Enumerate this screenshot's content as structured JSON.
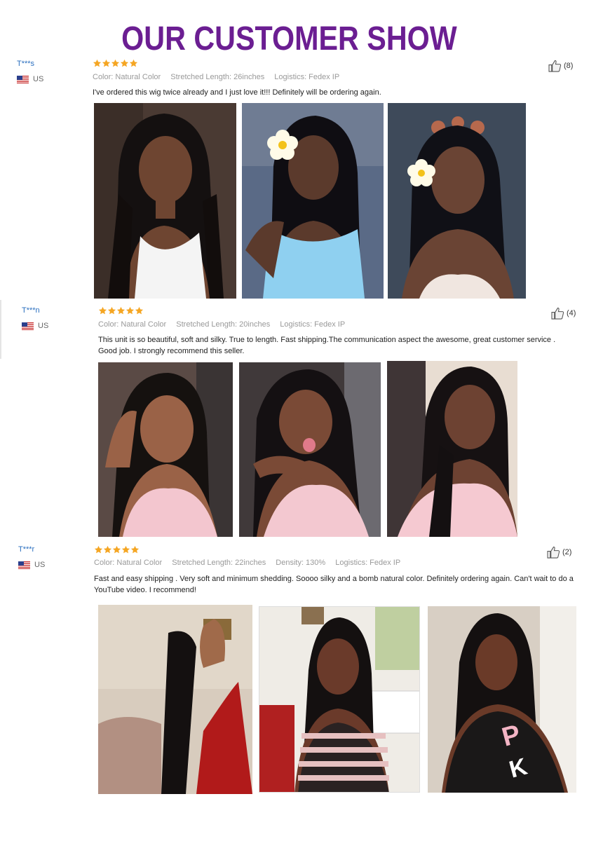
{
  "page": {
    "title": "OUR CUSTOMER SHOW"
  },
  "colors": {
    "title": "#6b1e92",
    "reviewer": "#2a6fbf",
    "star": "#f5a623"
  },
  "reviews": [
    {
      "reviewer": "T***s",
      "country": "US",
      "rating": 5,
      "helpful_count": "(8)",
      "meta": [
        "Color: Natural Color",
        "Stretched Length: 26inches",
        "Logistics: Fedex IP"
      ],
      "feedback": "I've ordered this wig twice already and I just love it!!! Definitely will be ordering again.",
      "photos": [
        "customer-photo-1",
        "customer-photo-2",
        "customer-photo-3"
      ]
    },
    {
      "reviewer": "T***n",
      "country": "US",
      "rating": 5,
      "helpful_count": "(4)",
      "meta": [
        "Color: Natural Color",
        "Stretched Length: 20inches",
        "Logistics: Fedex IP"
      ],
      "feedback": "This unit is so beautiful, soft and silky. True to length. Fast shipping.The communication aspect the awesome, great customer service . Good job. I strongly recommend this seller.",
      "photos": [
        "customer-photo-1",
        "customer-photo-2",
        "customer-photo-3"
      ]
    },
    {
      "reviewer": "T***r",
      "country": "US",
      "rating": 5,
      "helpful_count": "(2)",
      "meta": [
        "Color: Natural Color",
        "Stretched Length: 22inches",
        "Density: 130%",
        "Logistics: Fedex IP"
      ],
      "feedback": "Fast and easy shipping . Very soft and minimum shedding. Soooo silky and a bomb natural color. Definitely ordering again. Can't wait to do a YouTube video. I recommend!",
      "photos": [
        "customer-photo-1",
        "customer-photo-2",
        "customer-photo-3"
      ]
    }
  ]
}
